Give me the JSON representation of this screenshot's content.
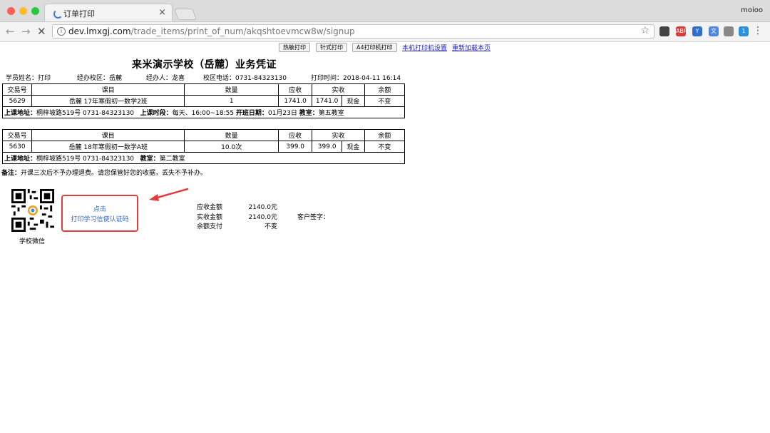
{
  "browser": {
    "tab_title": "订单打印",
    "close_glyph": "×",
    "profile": "moioo",
    "url_host": "dev.lmxgj.com",
    "url_path": "/trade_items/print_of_num/akqshtoevmcw8w/signup",
    "info_glyph": "i",
    "back_glyph": "←",
    "forward_glyph": "→",
    "reload_glyph": "✕",
    "star_glyph": "☆",
    "menu_glyph": "⋮",
    "extensions": [
      {
        "label": "",
        "color": "#444"
      },
      {
        "label": "ABP",
        "color": "#d73a3a"
      },
      {
        "label": "Y",
        "color": "#2f6fd0"
      },
      {
        "label": "文",
        "color": "#4e86e4"
      },
      {
        "label": "",
        "color": "#888"
      },
      {
        "label": "1",
        "color": "#2a91dd"
      }
    ]
  },
  "actions": {
    "btn1": "热敏打印",
    "btn2": "针式打印",
    "btn3": "A4打印机打印",
    "link1": "本机打印机设置",
    "link2": "重新加载本页"
  },
  "doc": {
    "title": "来米演示学校（岳麓）业务凭证",
    "info": [
      "学员姓名：打印",
      "经办校区：岳麓",
      "经办人：龙喜",
      "校区电话：0731-84323130",
      "打印时间：2018-04-11 16:14"
    ],
    "headers": [
      "交易号",
      "课目",
      "数量",
      "应收",
      "实收",
      "余额"
    ],
    "records": [
      {
        "id": "5629",
        "course": "岳麓 17年寒假初一数学2班",
        "qty": "1",
        "due": "1741.0",
        "paid": "1741.0",
        "method": "现金",
        "balance": "不变",
        "addr_label": "上课地址：",
        "addr_value": "桐梓坡路519号 0731-84323130",
        "time_label": "上课时段：",
        "time_value": "每天、16:00~18:55",
        "start_label": "开班日期：",
        "start_value": "01月23日",
        "room_label": "教室：",
        "room_value": "第五教室"
      },
      {
        "id": "5630",
        "course": "岳麓 18年寒假初一数学A班",
        "qty": "10.0次",
        "due": "399.0",
        "paid": "399.0",
        "method": "现金",
        "balance": "不变",
        "addr_label": "上课地址：",
        "addr_value": "桐梓坡路519号 0731-84323130",
        "room_label": "教室：",
        "room_value": "第二教室"
      }
    ],
    "note_label": "备注：",
    "note_text": "开课三次后不予办理退费。请您保管好您的收据，丢失不予补办。",
    "qr_label": "学校微信",
    "verify_line1": "点击",
    "verify_line2": "打印学习信使认证码",
    "summary": [
      {
        "label": "应收金额",
        "value": "2140.0元"
      },
      {
        "label": "实收金额",
        "value": "2140.0元"
      },
      {
        "label": "余额支付",
        "value": "不变"
      }
    ],
    "signature": "客户签字："
  },
  "colors": {
    "highlight": "#e23c3c",
    "link": "#2222bb",
    "verify_text": "#3366cc"
  }
}
